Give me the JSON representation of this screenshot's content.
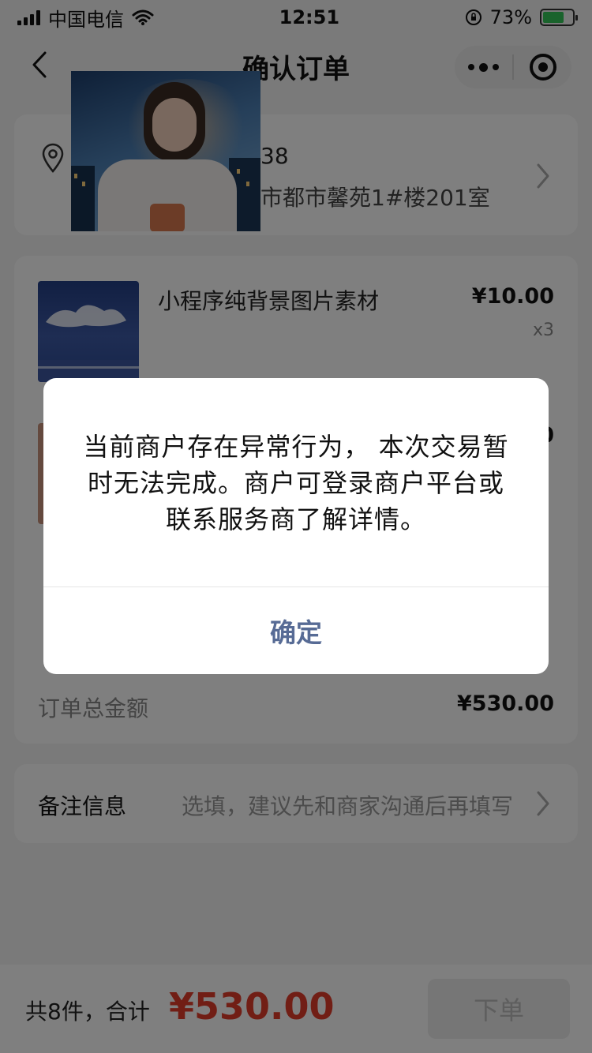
{
  "status_bar": {
    "carrier": "中国电信",
    "time": "12:51",
    "battery_percent": "73%"
  },
  "nav": {
    "title": "确认订单"
  },
  "address": {
    "name_partial": "38",
    "detail": "市都市馨苑1#楼201室"
  },
  "goods": [
    {
      "name": "小程序纯背景图片素材",
      "price": "¥10.00",
      "qty": "x3"
    }
  ],
  "second_item_price_partial": "0",
  "order_total": {
    "label": "订单总金额",
    "value": "¥530.00"
  },
  "remark": {
    "label": "备注信息",
    "placeholder": "选填，建议先和商家沟通后再填写"
  },
  "bottom": {
    "count_text": "共8件，合计",
    "total": "¥530.00",
    "submit_label": "下单"
  },
  "dialog": {
    "message": "当前商户存在异常行为， 本次交易暂时无法完成。商户可登录商户平台或联系服务商了解详情。",
    "confirm_label": "确定"
  },
  "colors": {
    "price_red": "#e23c2a",
    "dialog_button": "#576b95",
    "battery_green": "#35c759"
  }
}
